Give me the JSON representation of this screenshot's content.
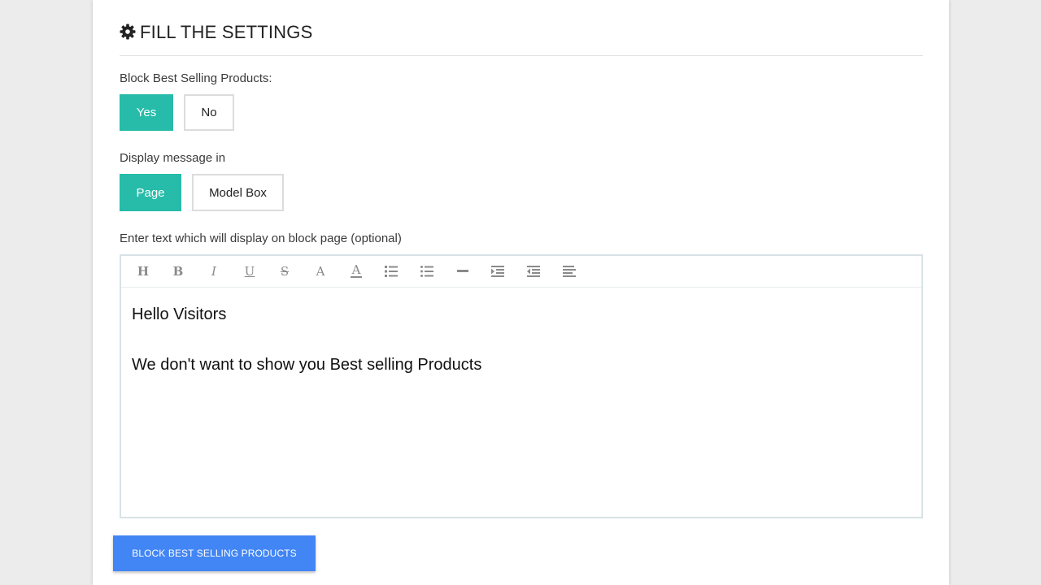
{
  "header": {
    "title": "FILL THE SETTINGS",
    "icon": "gear-icon"
  },
  "block_best_selling": {
    "label": "Block Best Selling Products:",
    "options": [
      "Yes",
      "No"
    ],
    "selected": "Yes"
  },
  "display_message": {
    "label": "Display message in",
    "options": [
      "Page",
      "Model Box"
    ],
    "selected": "Page"
  },
  "editor": {
    "label": "Enter text which will display on block page (optional)",
    "toolbar": [
      "heading-icon",
      "bold-icon",
      "italic-icon",
      "underline-icon",
      "strikethrough-icon",
      "font-size-icon",
      "text-color-icon",
      "ordered-list-icon",
      "unordered-list-icon",
      "horizontal-rule-icon",
      "indent-icon",
      "outdent-icon",
      "align-icon"
    ],
    "content": [
      "Hello Visitors",
      "We don't want to show you Best selling Products"
    ]
  },
  "submit_label": "BLOCK BEST SELLING PRODUCTS",
  "colors": {
    "accent": "#26bca9",
    "primary_button": "#4285f4"
  }
}
